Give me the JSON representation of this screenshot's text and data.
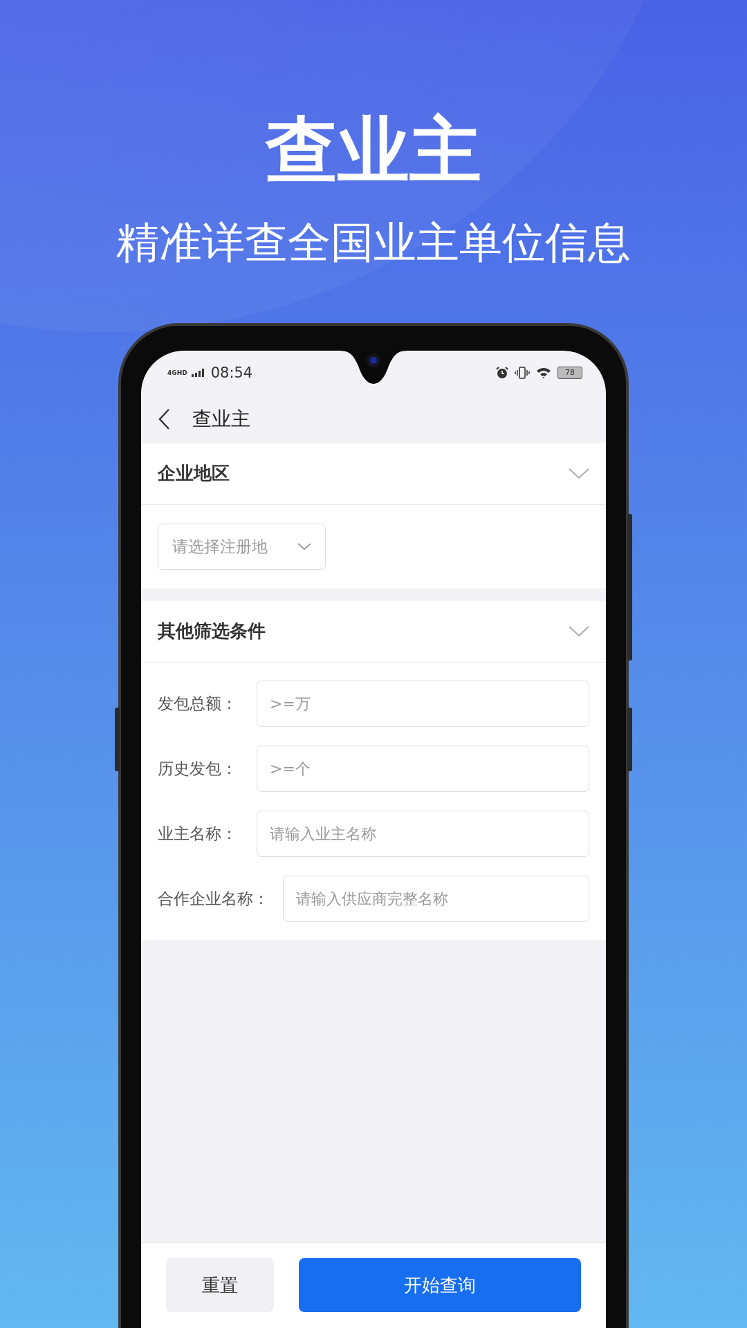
{
  "headline": "查业主",
  "subtitle": "精准详查全国业主单位信息",
  "status_bar": {
    "network": "4GHD",
    "time": "08:54",
    "battery": "78"
  },
  "nav": {
    "title": "查业主"
  },
  "region_section": {
    "title": "企业地区",
    "select": {
      "placeholder": "请选择注册地"
    }
  },
  "filter_section": {
    "title": "其他筛选条件",
    "fields": [
      {
        "label": "发包总额：",
        "placeholder": ">=万"
      },
      {
        "label": "历史发包：",
        "placeholder": ">=个"
      },
      {
        "label": "业主名称：",
        "placeholder": "请输入业主名称"
      },
      {
        "label": "合作企业名称：",
        "placeholder": "请输入供应商完整名称"
      }
    ]
  },
  "buttons": [
    {
      "label": "重置",
      "kind": "secondary"
    },
    {
      "label": "开始查询",
      "kind": "primary"
    }
  ]
}
